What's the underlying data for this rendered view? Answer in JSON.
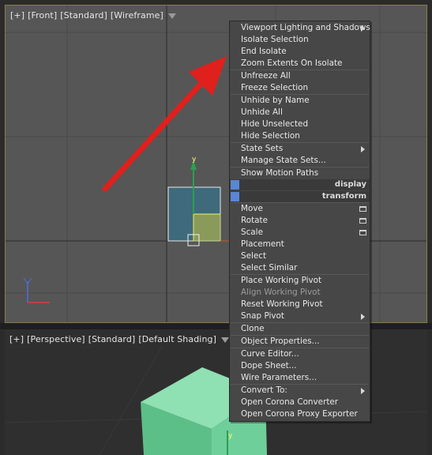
{
  "front_viewport": {
    "label_parts": [
      "[+]",
      "[Front]",
      "[Standard]",
      "[Wireframe]"
    ],
    "axes": {
      "up": "y",
      "right": "x",
      "tripod_up": "z"
    }
  },
  "perspective_viewport": {
    "label_parts": [
      "[+]",
      "[Perspective]",
      "[Standard]",
      "[Default Shading]"
    ]
  },
  "colors": {
    "accent_arrow": "#e0201c",
    "selection_blue": "#5a86d6",
    "object_face_blue": "#3f6a7c",
    "object_face_yellow": "#8a9a5a",
    "perspective_box": "#6fcf9a"
  },
  "context_menu": {
    "group1": [
      {
        "label": "Viewport Lighting and Shadows",
        "submenu": true
      },
      {
        "label": "Isolate Selection"
      },
      {
        "label": "End Isolate"
      },
      {
        "label": "Zoom Extents On Isolate"
      }
    ],
    "group2": [
      {
        "label": "Unfreeze All"
      },
      {
        "label": "Freeze Selection"
      }
    ],
    "group3": [
      {
        "label": "Unhide by Name"
      },
      {
        "label": "Unhide All"
      },
      {
        "label": "Hide Unselected"
      },
      {
        "label": "Hide Selection"
      }
    ],
    "group4": [
      {
        "label": "State Sets",
        "submenu": true
      },
      {
        "label": "Manage State Sets..."
      }
    ],
    "group5": [
      {
        "label": "Show Motion Paths"
      }
    ],
    "quad_display": "display",
    "quad_transform": "transform",
    "group6": [
      {
        "label": "Move",
        "box": true
      },
      {
        "label": "Rotate",
        "box": true
      },
      {
        "label": "Scale",
        "box": true
      },
      {
        "label": "Placement"
      },
      {
        "label": "Select"
      },
      {
        "label": "Select Similar"
      }
    ],
    "group7": [
      {
        "label": "Place Working Pivot"
      },
      {
        "label": "Align Working Pivot",
        "dim": true
      },
      {
        "label": "Reset Working Pivot"
      },
      {
        "label": "Snap Pivot",
        "submenu": true
      }
    ],
    "group8": [
      {
        "label": "Clone"
      }
    ],
    "group9": [
      {
        "label": "Object Properties..."
      }
    ],
    "group10": [
      {
        "label": "Curve Editor..."
      },
      {
        "label": "Dope Sheet..."
      },
      {
        "label": "Wire Parameters..."
      }
    ],
    "group11": [
      {
        "label": "Convert To:",
        "submenu": true
      },
      {
        "label": "Open Corona Converter"
      },
      {
        "label": "Open Corona Proxy Exporter"
      }
    ]
  }
}
